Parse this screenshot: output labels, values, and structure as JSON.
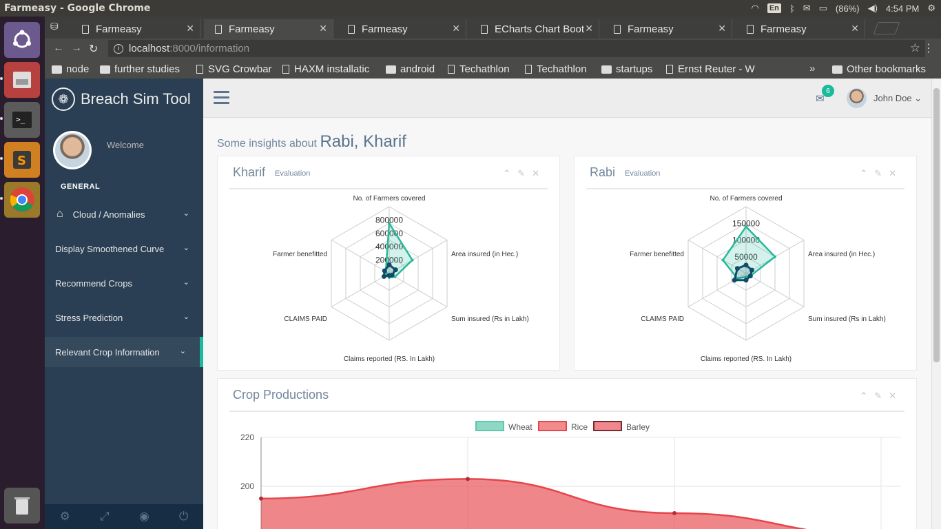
{
  "window_title": "Farmeasy - Google Chrome",
  "tray": {
    "lang": "En",
    "battery": "(86%)",
    "time": "4:54 PM"
  },
  "tabs": [
    {
      "title": "Farmeasy",
      "active": false
    },
    {
      "title": "Farmeasy",
      "active": true
    },
    {
      "title": "Farmeasy",
      "active": false
    },
    {
      "title": "ECharts Chart Boot",
      "active": false
    },
    {
      "title": "Farmeasy",
      "active": false
    },
    {
      "title": "Farmeasy",
      "active": false
    }
  ],
  "address": {
    "host": "localhost",
    "path": ":8000/information"
  },
  "bookmarks": [
    {
      "label": "node",
      "type": "folder"
    },
    {
      "label": "further studies",
      "type": "folder"
    },
    {
      "label": "SVG Crowbar",
      "type": "doc"
    },
    {
      "label": "HAXM installatic",
      "type": "doc"
    },
    {
      "label": "android",
      "type": "folder"
    },
    {
      "label": "Techathlon",
      "type": "doc"
    },
    {
      "label": "Techathlon",
      "type": "doc"
    },
    {
      "label": "startups",
      "type": "folder"
    },
    {
      "label": "Ernst Reuter - W",
      "type": "doc"
    }
  ],
  "other_bookmarks": "Other bookmarks",
  "brand": "Breach Sim Tool",
  "welcome": "Welcome",
  "section": "GENERAL",
  "menu": [
    {
      "label": "Cloud / Anomalies",
      "icon": "home-icon"
    },
    {
      "label": "Display Smoothened Curve"
    },
    {
      "label": "Recommend Crops"
    },
    {
      "label": "Stress Prediction"
    },
    {
      "label": "Relevant Crop Information",
      "active": true
    }
  ],
  "topnav": {
    "messages": "6",
    "user": "John Doe"
  },
  "page": {
    "prefix": "Some insights about",
    "highlight": "Rabi, Kharif"
  },
  "panels": {
    "kharif": {
      "title": "Kharif",
      "subtitle": "Evaluation"
    },
    "rabi": {
      "title": "Rabi",
      "subtitle": "Evaluation"
    },
    "crop": {
      "title": "Crop Productions"
    }
  },
  "chart_data": [
    {
      "type": "radar",
      "indicators": [
        "No. of Farmers covered",
        "Area insured (in Hec.)",
        "Sum insured (Rs in Lakh)",
        "Claims reported (RS. In Lakh)",
        "CLAIMS PAID",
        "Farmer benefitted"
      ],
      "max": 1000000,
      "ticks": [
        "800000",
        "600000",
        "400000",
        "200000"
      ],
      "series": [
        {
          "color": "#26b99a",
          "values": [
            750000,
            400000,
            100000,
            60000,
            40000,
            60000
          ]
        },
        {
          "color": "#0e4c67",
          "values": [
            130000,
            110000,
            50000,
            30000,
            90000,
            80000
          ]
        }
      ]
    },
    {
      "type": "radar",
      "indicators": [
        "No. of Farmers covered",
        "Area insured (in Hec.)",
        "Sum insured (Rs in Lakh)",
        "Claims reported (RS. In Lakh)",
        "CLAIMS PAID",
        "Farmer benefitted"
      ],
      "max": 200000,
      "ticks": [
        "150000",
        "100000",
        "50000"
      ],
      "series": [
        {
          "color": "#26b99a",
          "values": [
            140000,
            100000,
            15000,
            10000,
            30000,
            80000
          ]
        },
        {
          "color": "#0e4c67",
          "values": [
            25000,
            20000,
            15000,
            20000,
            40000,
            30000
          ]
        }
      ]
    },
    {
      "type": "area",
      "legend": [
        "Wheat",
        "Rice",
        "Barley"
      ],
      "legend_colors": [
        [
          "#8fd8c6",
          "#5cc8ac"
        ],
        [
          "#f28c8c",
          "#e5454b"
        ],
        [
          "#f0878c",
          "#7a2b2f"
        ]
      ],
      "ylim": [
        180,
        220
      ],
      "yticks": [
        "220",
        "200"
      ],
      "series": [
        {
          "name": "Rice",
          "values": [
            195,
            203,
            189,
            180
          ]
        }
      ]
    }
  ]
}
